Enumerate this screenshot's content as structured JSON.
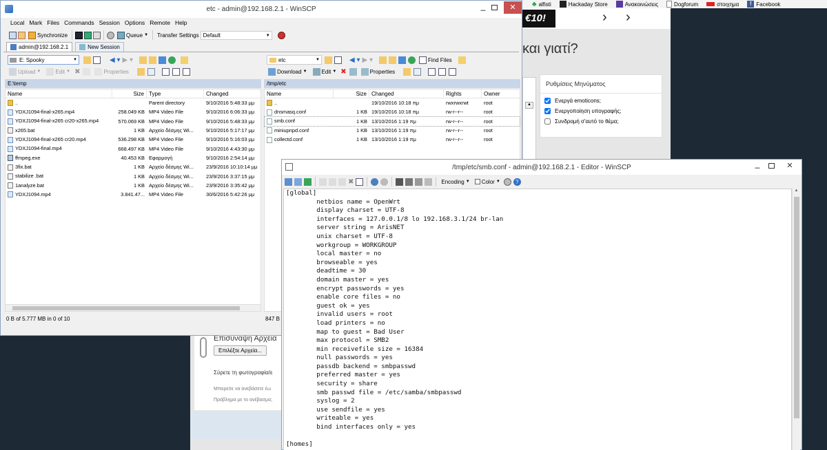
{
  "bookmarks": {
    "items": [
      {
        "label": "alfisti",
        "icon": "clover-icon"
      },
      {
        "label": "Hackaday Store",
        "icon": "hackaday-icon"
      },
      {
        "label": "Ανακοινώσεις",
        "icon": "bookmark-icon"
      },
      {
        "label": "Dogforum",
        "icon": "page-icon"
      },
      {
        "label": "στοιχημα",
        "icon": "bet-icon"
      },
      {
        "label": "Facebook",
        "icon": "facebook-icon"
      }
    ]
  },
  "background_page": {
    "banner": "€10!",
    "heading": "και γιατί?",
    "message_settings": {
      "title": "Ρυθμίσεις Μηνύματος",
      "options": [
        {
          "label": "Ενεργά emoticons;",
          "checked": true
        },
        {
          "label": "Ενεργοποίηση υπογραφής;",
          "checked": true
        },
        {
          "label": "Συνδρομή σ'αυτό το θέμα;",
          "checked": false
        }
      ]
    },
    "attach": {
      "heading": "Επισύναψη Αρχεία",
      "select_button": "Επιλέξτε Αρχεία...",
      "drag_text": "Σύρετε τη φωτογραφία/ε",
      "hint1": "Μπορείτε να ανεβάσετε έω",
      "hint2": "Πρόβλημα με το ανέβασμα;"
    }
  },
  "winscp": {
    "title": "etc - admin@192.168.2.1 - WinSCP",
    "menu": [
      "Local",
      "Mark",
      "Files",
      "Commands",
      "Session",
      "Options",
      "Remote",
      "Help"
    ],
    "toolbar": {
      "synchronize": "Synchronize",
      "queue": "Queue",
      "transfer_settings_label": "Transfer Settings",
      "transfer_settings_value": "Default"
    },
    "tabs": {
      "active": "admin@192.168.2.1",
      "new_session": "New Session"
    },
    "local": {
      "drive": "E: Spooky",
      "upload": "Upload",
      "edit": "Edit",
      "properties": "Properties",
      "path": "E:\\temp",
      "columns": [
        "Name",
        "Size",
        "Type",
        "Changed"
      ],
      "rows": [
        {
          "name": "..",
          "size": "",
          "type": "Parent directory",
          "changed": "9/10/2016 5:48:33 μμ",
          "icon": "folder"
        },
        {
          "name": "YDXJ1094-final-x265.mp4",
          "size": "258.049 KB",
          "type": "MP4 Video File",
          "changed": "9/10/2016 6:06:33 μμ",
          "icon": "video"
        },
        {
          "name": "YDXJ1094-final-x265 cr20-x265.mp4",
          "size": "570.069 KB",
          "type": "MP4 Video File",
          "changed": "9/10/2016 5:48:33 μμ",
          "icon": "video"
        },
        {
          "name": "x265.bat",
          "size": "1 KB",
          "type": "Αρχείο δέσμης Wi...",
          "changed": "9/10/2016 5:17:17 μμ",
          "icon": "bat"
        },
        {
          "name": "YDXJ1094-final-x265 cr20.mp4",
          "size": "536.298 KB",
          "type": "MP4 Video File",
          "changed": "9/10/2016 5:16:03 μμ",
          "icon": "video"
        },
        {
          "name": "YDXJ1094-final.mp4",
          "size": "668.497 KB",
          "type": "MP4 Video File",
          "changed": "9/10/2016 4:43:30 μμ",
          "icon": "video"
        },
        {
          "name": "ffmpeg.exe",
          "size": "40.453 KB",
          "type": "Εφαρμογή",
          "changed": "9/10/2016 2:54:14 μμ",
          "icon": "exe"
        },
        {
          "name": "3fix.bat",
          "size": "1 KB",
          "type": "Αρχείο δέσμης Wi...",
          "changed": "23/9/2016 10:10:14 μμ",
          "icon": "bat"
        },
        {
          "name": "stabilize .bat",
          "size": "1 KB",
          "type": "Αρχείο δέσμης Wi...",
          "changed": "23/9/2016 3:37:15 μμ",
          "icon": "bat"
        },
        {
          "name": "1analyze.bat",
          "size": "1 KB",
          "type": "Αρχείο δέσμης Wi...",
          "changed": "23/9/2016 3:35:42 μμ",
          "icon": "bat"
        },
        {
          "name": "YDXJ1094.mp4",
          "size": "3.841.47...",
          "type": "MP4 Video File",
          "changed": "30/6/2016 5:42:26 μμ",
          "icon": "video"
        }
      ],
      "status": "0 B of 5.777 MB in 0 of 10"
    },
    "remote": {
      "dir": "etc",
      "find_files": "Find Files",
      "download": "Download",
      "edit": "Edit",
      "properties": "Properties",
      "path": "/tmp/etc",
      "columns": [
        "Name",
        "Size",
        "Changed",
        "Rights",
        "Owner"
      ],
      "rows": [
        {
          "name": "..",
          "size": "",
          "changed": "19/10/2016 10:18 πμ",
          "rights": "rwxrwxrwt",
          "owner": "root",
          "icon": "folder"
        },
        {
          "name": "dnsmasq.conf",
          "size": "1 KB",
          "changed": "19/10/2016 10:18 πμ",
          "rights": "rw-r--r--",
          "owner": "root",
          "icon": "file"
        },
        {
          "name": "smb.conf",
          "size": "1 KB",
          "changed": "13/10/2016 1:19 πμ",
          "rights": "rw-r--r--",
          "owner": "root",
          "icon": "file"
        },
        {
          "name": "miniupnpd.conf",
          "size": "1 KB",
          "changed": "13/10/2016 1:19 πμ",
          "rights": "rw-r--r--",
          "owner": "root",
          "icon": "file"
        },
        {
          "name": "collectd.conf",
          "size": "1 KB",
          "changed": "13/10/2016 1:19 πμ",
          "rights": "rw-r--r--",
          "owner": "root",
          "icon": "file"
        }
      ],
      "status": "847 B"
    }
  },
  "editor": {
    "title": "/tmp/etc/smb.conf - admin@192.168.2.1 - Editor - WinSCP",
    "encoding": "Encoding",
    "color": "Color",
    "lines": [
      "[global]",
      "        netbios name = OpenWrt",
      "        display charset = UTF-8",
      "        interfaces = 127.0.0.1/8 lo 192.168.3.1/24 br-lan",
      "        server string = ArisNET",
      "        unix charset = UTF-8",
      "        workgroup = WORKGROUP",
      "        local master = no",
      "        browseable = yes",
      "        deadtime = 30",
      "        domain master = yes",
      "        encrypt passwords = yes",
      "        enable core files = no",
      "        guest ok = yes",
      "        invalid users = root",
      "        load printers = no",
      "        map to guest = Bad User",
      "        max protocol = SMB2",
      "        min receivefile size = 16384",
      "        null passwords = yes",
      "        passdb backend = smbpasswd",
      "        preferred master = yes",
      "        security = share",
      "        smb passwd file = /etc/samba/smbpasswd",
      "        syslog = 2",
      "        use sendfile = yes",
      "        writeable = yes",
      "        bind interfaces only = yes",
      "",
      "[homes]"
    ]
  }
}
